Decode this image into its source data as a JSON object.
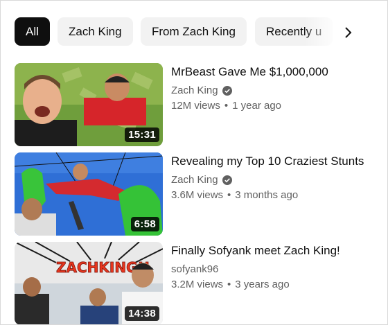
{
  "chips": [
    {
      "label": "All",
      "active": true
    },
    {
      "label": "Zach King",
      "active": false
    },
    {
      "label": "From Zach King",
      "active": false
    },
    {
      "label": "Recently u",
      "active": false
    }
  ],
  "videos": [
    {
      "title": "MrBeast Gave Me $1,000,000",
      "channel": "Zach King",
      "verified": true,
      "views": "12M views",
      "age": "1 year ago",
      "duration": "15:31"
    },
    {
      "title": "Revealing my Top 10 Craziest Stunts",
      "channel": "Zach King",
      "verified": true,
      "views": "3.6M views",
      "age": "3 months ago",
      "duration": "6:58"
    },
    {
      "title": "Finally Sofyank meet Zach King!",
      "channel": "sofyank96",
      "verified": false,
      "views": "3.2M views",
      "age": "3 years ago",
      "duration": "14:38",
      "thumb_text": "ZACHKING!!"
    }
  ],
  "icons": {
    "next": "chevron-right-icon",
    "verified": "verified-badge-icon"
  },
  "colors": {
    "active_chip_bg": "#0f0f0f",
    "chip_bg": "#f2f2f2",
    "secondary_text": "#606060"
  }
}
